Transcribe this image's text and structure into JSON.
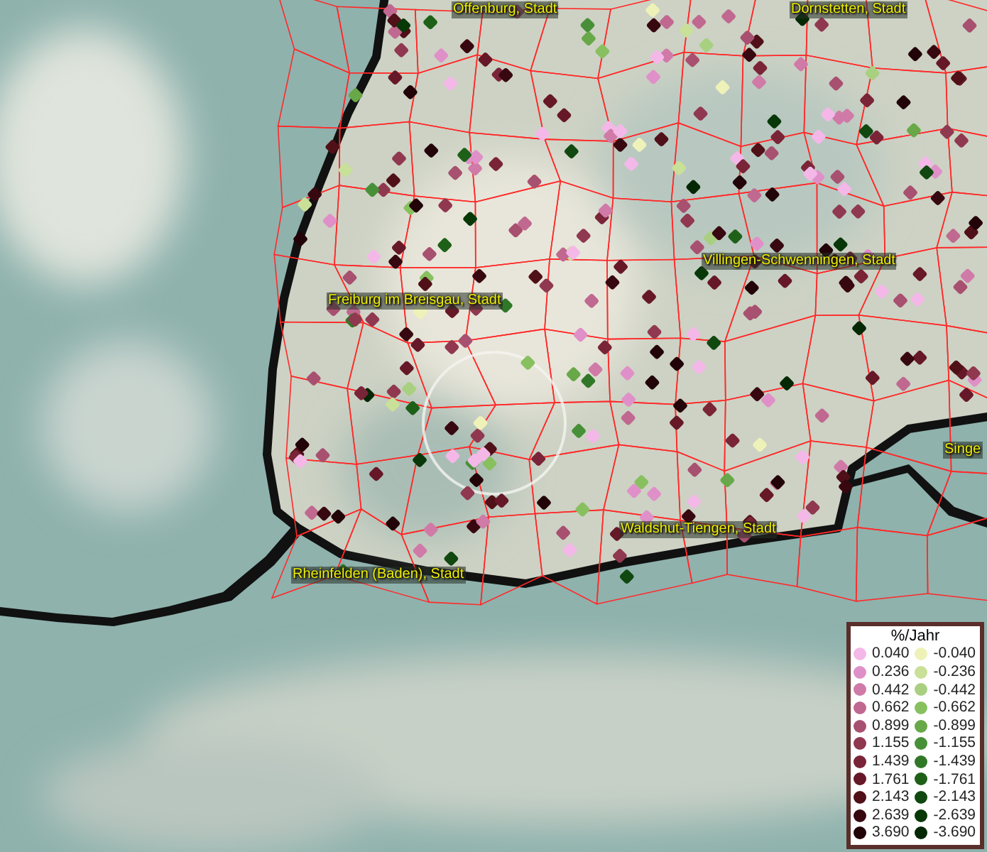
{
  "map": {
    "place_labels": [
      {
        "text": "Offenburg, Stadt"
      },
      {
        "text": "Dornstetten, Stadt"
      },
      {
        "text": "Freiburg im Breisgau, Stadt"
      },
      {
        "text": "Villingen-Schwenningen, Stadt"
      },
      {
        "text": "Waldshut-Tiengen, Stadt"
      },
      {
        "text": "Rheinfelden (Baden), Stadt"
      },
      {
        "text": "Singe"
      }
    ]
  },
  "legend": {
    "title": "%/Jahr",
    "rows": [
      {
        "positive": {
          "label": "0.040",
          "color": "#f4b8e8"
        },
        "negative": {
          "label": "-0.040",
          "color": "#eef2b8"
        }
      },
      {
        "positive": {
          "label": "0.236",
          "color": "#e090c8"
        },
        "negative": {
          "label": "-0.236",
          "color": "#c8e098"
        }
      },
      {
        "positive": {
          "label": "0.442",
          "color": "#d07aa8"
        },
        "negative": {
          "label": "-0.442",
          "color": "#a8d080"
        }
      },
      {
        "positive": {
          "label": "0.662",
          "color": "#c06890"
        },
        "negative": {
          "label": "-0.662",
          "color": "#88c060"
        }
      },
      {
        "positive": {
          "label": "0.899",
          "color": "#a85070"
        },
        "negative": {
          "label": "-0.899",
          "color": "#68a848"
        }
      },
      {
        "positive": {
          "label": "1.155",
          "color": "#903850"
        },
        "negative": {
          "label": "-1.155",
          "color": "#489038"
        }
      },
      {
        "positive": {
          "label": "1.439",
          "color": "#7a2438"
        },
        "negative": {
          "label": "-1.439",
          "color": "#307828"
        }
      },
      {
        "positive": {
          "label": "1.761",
          "color": "#661828"
        },
        "negative": {
          "label": "-1.761",
          "color": "#1e6018"
        }
      },
      {
        "positive": {
          "label": "2.143",
          "color": "#501018"
        },
        "negative": {
          "label": "-2.143",
          "color": "#104810"
        }
      },
      {
        "positive": {
          "label": "2.639",
          "color": "#380810"
        },
        "negative": {
          "label": "-2.639",
          "color": "#083808"
        }
      },
      {
        "positive": {
          "label": "3.690",
          "color": "#220408"
        },
        "negative": {
          "label": "-3.690",
          "color": "#042804"
        }
      }
    ]
  }
}
